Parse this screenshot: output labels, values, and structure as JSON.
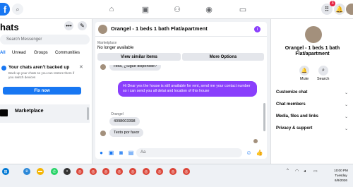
{
  "nav": {
    "logo_letter": "f",
    "notification_count": "3"
  },
  "left_panel": {
    "title": "hats",
    "search_placeholder": "Search Messenger",
    "filters": [
      "All",
      "Unread",
      "Groups",
      "Communities"
    ],
    "backup": {
      "title": "Your chats aren't backed up",
      "text": "Back up your chats so you can restore them if you switch devices",
      "button": "Fix now"
    },
    "marketplace_label": "Marketplace"
  },
  "chat": {
    "title": "Orangel - 1 beds 1 bath Flat/apartment",
    "marketplace_label": "Marketplace",
    "listing_status": "No longer available",
    "buttons": {
      "similar": "View similar items",
      "more": "More Options"
    },
    "messages": [
      {
        "type": "in",
        "text": "Hola, ¿Sigue disponible?"
      },
      {
        "type": "out",
        "text": "Hi Dear yes the house is still available for rent, send me your contact number so i can send you all detai and location of this house"
      },
      {
        "type": "sender",
        "text": "Orangel"
      },
      {
        "type": "in",
        "text": "4098003398"
      },
      {
        "type": "in",
        "text": "Texto por favor"
      }
    ],
    "composer_placeholder": "Aa"
  },
  "right_panel": {
    "title": "Orangel - 1 beds 1 bath Flat/apartment",
    "actions": [
      "Mute",
      "Search"
    ],
    "items": [
      "Customize chat",
      "Chat members",
      "Media, files and links",
      "Privacy & support"
    ]
  },
  "taskbar": {
    "time": "10:00 PM",
    "day": "Tuesday",
    "date": "6/9/2026"
  },
  "colors": {
    "accent": "#1877f2",
    "outgoing_bubble": "#8a3ffc",
    "badge": "#e41e3f"
  }
}
